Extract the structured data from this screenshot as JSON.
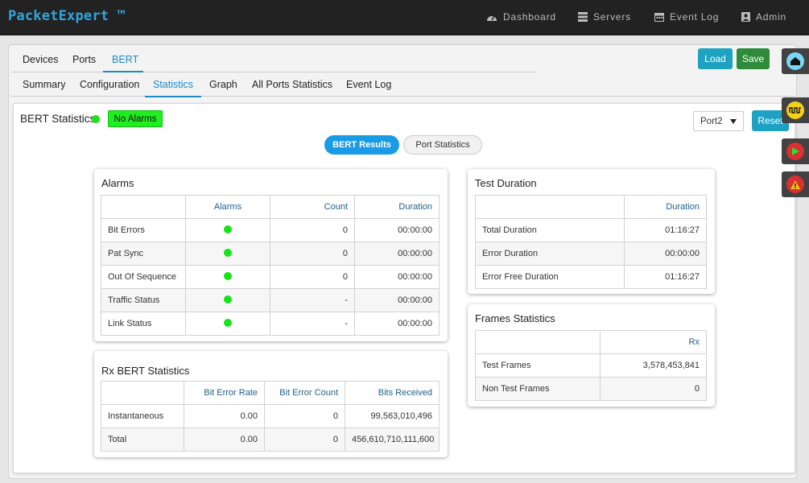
{
  "app": {
    "brand": "PacketExpert ™"
  },
  "nav": [
    {
      "label": "Dashboard",
      "icon": "dashboard-icon"
    },
    {
      "label": "Servers",
      "icon": "servers-icon"
    },
    {
      "label": "Event Log",
      "icon": "calendar-icon"
    },
    {
      "label": "Admin",
      "icon": "user-icon"
    }
  ],
  "tabs_primary": [
    "Devices",
    "Ports",
    "BERT"
  ],
  "tabs_secondary": [
    "Summary",
    "Configuration",
    "Statistics",
    "Graph",
    "All Ports Statistics",
    "Event Log"
  ],
  "toolbar": {
    "load": "Load",
    "save": "Save"
  },
  "bert": {
    "title": "BERT Statistics",
    "status_badge": "No Alarms",
    "port_selected": "Port2",
    "reset": "Reset",
    "pill_results": "BERT Results",
    "pill_port_stats": "Port Statistics"
  },
  "alarms": {
    "title": "Alarms",
    "headers": [
      "",
      "Alarms",
      "Count",
      "Duration"
    ],
    "rows": [
      {
        "label": "Bit Errors",
        "count": "0",
        "duration": "00:00:00"
      },
      {
        "label": "Pat Sync",
        "count": "0",
        "duration": "00:00:00"
      },
      {
        "label": "Out Of Sequence",
        "count": "0",
        "duration": "00:00:00"
      },
      {
        "label": "Traffic Status",
        "count": "-",
        "duration": "00:00:00"
      },
      {
        "label": "Link Status",
        "count": "-",
        "duration": "00:00:00"
      }
    ]
  },
  "rx": {
    "title": "Rx BERT Statistics",
    "headers": [
      "",
      "Bit Error Rate",
      "Bit Error Count",
      "Bits Received"
    ],
    "rows": [
      {
        "label": "Instantaneous",
        "ber": "0.00",
        "bec": "0",
        "bits": "99,563,010,496"
      },
      {
        "label": "Total",
        "ber": "0.00",
        "bec": "0",
        "bits": "456,610,710,111,600"
      }
    ]
  },
  "duration": {
    "title": "Test Duration",
    "headers": [
      "",
      "Duration"
    ],
    "rows": [
      {
        "label": "Total Duration",
        "value": "01:16:27"
      },
      {
        "label": "Error Duration",
        "value": "00:00:00"
      },
      {
        "label": "Error Free Duration",
        "value": "01:16:27"
      }
    ]
  },
  "frames": {
    "title": "Frames Statistics",
    "headers": [
      "",
      "Rx"
    ],
    "rows": [
      {
        "label": "Test Frames",
        "value": "3,578,453,841"
      },
      {
        "label": "Non Test Frames",
        "value": "0"
      }
    ]
  },
  "side_widgets": [
    "home-icon",
    "waveform-icon",
    "play-icon",
    "warning-icon"
  ],
  "colors": {
    "accent": "#1a8bc7",
    "alarm_ok": "#17e317",
    "save": "#2e8b39",
    "load": "#1ea2c2"
  }
}
